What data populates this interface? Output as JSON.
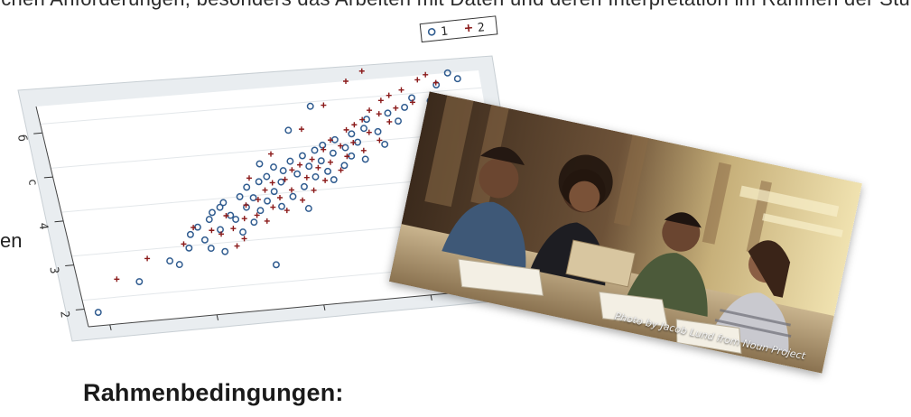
{
  "page": {
    "top_fragment": "ichen Anforderungen, besonders das Arbeiten mit Daten und deren Interpretation im Rahmen der Studie",
    "side_fragment": "en",
    "heading": "Rahmenbedingungen:"
  },
  "chart_data": {
    "type": "scatter",
    "title": "",
    "xlabel": "",
    "ylabel": "",
    "ytick_labels": [
      "б",
      "с",
      "4",
      "3",
      "2"
    ],
    "legend": {
      "placement": "top-right"
    },
    "grid": true,
    "xlim": [
      0,
      100
    ],
    "ylim": [
      0,
      100
    ],
    "series": [
      {
        "name": "1",
        "marker": "circle",
        "color": "#2f5b8f",
        "points": [
          [
            3,
            6
          ],
          [
            14,
            18
          ],
          [
            22,
            26
          ],
          [
            24,
            24
          ],
          [
            27,
            31
          ],
          [
            28,
            37
          ],
          [
            30,
            40
          ],
          [
            31,
            34
          ],
          [
            32,
            30
          ],
          [
            33,
            43
          ],
          [
            34,
            46
          ],
          [
            35,
            38
          ],
          [
            35,
            28
          ],
          [
            36,
            48
          ],
          [
            37,
            50
          ],
          [
            38,
            44
          ],
          [
            39,
            42
          ],
          [
            40,
            36
          ],
          [
            41,
            52
          ],
          [
            42,
            47
          ],
          [
            43,
            40
          ],
          [
            43,
            56
          ],
          [
            44,
            51
          ],
          [
            45,
            45
          ],
          [
            46,
            58
          ],
          [
            46,
            20
          ],
          [
            47,
            49
          ],
          [
            48,
            60
          ],
          [
            49,
            53
          ],
          [
            50,
            46
          ],
          [
            50,
            64
          ],
          [
            51,
            57
          ],
          [
            52,
            62
          ],
          [
            53,
            50
          ],
          [
            54,
            66
          ],
          [
            55,
            60
          ],
          [
            56,
            54
          ],
          [
            56,
            44
          ],
          [
            57,
            68
          ],
          [
            58,
            63
          ],
          [
            59,
            58
          ],
          [
            60,
            70
          ],
          [
            61,
            65
          ],
          [
            62,
            60
          ],
          [
            62,
            72
          ],
          [
            63,
            56
          ],
          [
            64,
            68
          ],
          [
            65,
            74
          ],
          [
            66,
            62
          ],
          [
            67,
            70
          ],
          [
            68,
            66
          ],
          [
            69,
            76
          ],
          [
            70,
            72
          ],
          [
            71,
            64
          ],
          [
            72,
            78
          ],
          [
            73,
            82
          ],
          [
            75,
            76
          ],
          [
            76,
            70
          ],
          [
            78,
            84
          ],
          [
            80,
            80
          ],
          [
            82,
            86
          ],
          [
            84,
            90
          ],
          [
            86,
            62
          ],
          [
            88,
            88
          ],
          [
            90,
            95
          ],
          [
            93,
            100
          ],
          [
            95,
            97
          ],
          [
            61,
            90
          ],
          [
            55,
            80
          ],
          [
            47,
            66
          ]
        ]
      },
      {
        "name": "2",
        "marker": "plus",
        "color": "#8b1a1a",
        "points": [
          [
            9,
            20
          ],
          [
            17,
            28
          ],
          [
            26,
            33
          ],
          [
            29,
            40
          ],
          [
            33,
            38
          ],
          [
            35,
            36
          ],
          [
            37,
            44
          ],
          [
            38,
            38
          ],
          [
            40,
            33
          ],
          [
            41,
            42
          ],
          [
            42,
            48
          ],
          [
            44,
            43
          ],
          [
            45,
            50
          ],
          [
            46,
            40
          ],
          [
            47,
            54
          ],
          [
            48,
            46
          ],
          [
            49,
            57
          ],
          [
            50,
            50
          ],
          [
            51,
            44
          ],
          [
            52,
            58
          ],
          [
            53,
            53
          ],
          [
            54,
            62
          ],
          [
            55,
            48
          ],
          [
            56,
            64
          ],
          [
            57,
            58
          ],
          [
            58,
            52
          ],
          [
            59,
            66
          ],
          [
            60,
            62
          ],
          [
            61,
            56
          ],
          [
            62,
            70
          ],
          [
            63,
            64
          ],
          [
            64,
            74
          ],
          [
            65,
            60
          ],
          [
            66,
            71
          ],
          [
            67,
            66
          ],
          [
            68,
            78
          ],
          [
            69,
            72
          ],
          [
            70,
            80
          ],
          [
            71,
            68
          ],
          [
            72,
            82
          ],
          [
            73,
            76
          ],
          [
            74,
            86
          ],
          [
            75,
            72
          ],
          [
            76,
            84
          ],
          [
            77,
            90
          ],
          [
            78,
            80
          ],
          [
            79,
            92
          ],
          [
            80,
            86
          ],
          [
            82,
            94
          ],
          [
            84,
            88
          ],
          [
            86,
            98
          ],
          [
            88,
            100
          ],
          [
            90,
            96
          ],
          [
            74,
            104
          ],
          [
            70,
            100
          ],
          [
            64,
            90
          ],
          [
            58,
            80
          ],
          [
            50,
            70
          ],
          [
            44,
            60
          ],
          [
            38,
            30
          ]
        ]
      }
    ]
  },
  "photo": {
    "caption": "Photo by Jacob Lund from Noun Project"
  }
}
